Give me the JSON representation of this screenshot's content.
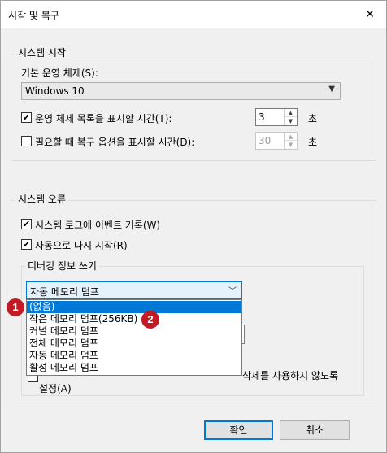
{
  "window": {
    "title": "시작 및 복구",
    "close_label": "✕"
  },
  "system_startup": {
    "legend": "시스템 시작",
    "default_os_label": "기본 운영 체제(S):",
    "default_os_value": "Windows 10",
    "show_os_list": {
      "label": "운영 체제 목록을 표시할 시간(T):",
      "checked": "✔",
      "value": "3",
      "unit": "초"
    },
    "show_recovery": {
      "label": "필요할 때 복구 옵션을 표시할 시간(D):",
      "checked": "",
      "value": "30",
      "unit": "초"
    }
  },
  "system_failure": {
    "legend": "시스템 오류",
    "write_event": {
      "label": "시스템 로그에 이벤트 기록(W)",
      "checked": "✔"
    },
    "auto_restart": {
      "label": "자동으로 다시 시작(R)",
      "checked": "✔"
    },
    "debug_info": {
      "legend": "디버깅 정보 쓰기",
      "selected": "자동 메모리 덤프",
      "options": [
        "(없음)",
        "작은 메모리 덤프(256KB)",
        "커널 메모리 덤프",
        "전체 메모리 덤프",
        "자동 메모리 덤프",
        "활성 메모리 덤프"
      ],
      "partial_text_1": "삭제를 사용하지 않도록",
      "partial_text_2": "설정(A)"
    }
  },
  "badges": [
    "1",
    "2"
  ],
  "buttons": {
    "ok": "확인",
    "cancel": "취소"
  },
  "icons": {
    "close": "close-icon",
    "dropdown": "chevron-down-icon",
    "spin_up": "arrow-up-icon",
    "spin_down": "arrow-down-icon"
  },
  "colors": {
    "selection": "#0078d7",
    "badge": "#c21b24"
  }
}
